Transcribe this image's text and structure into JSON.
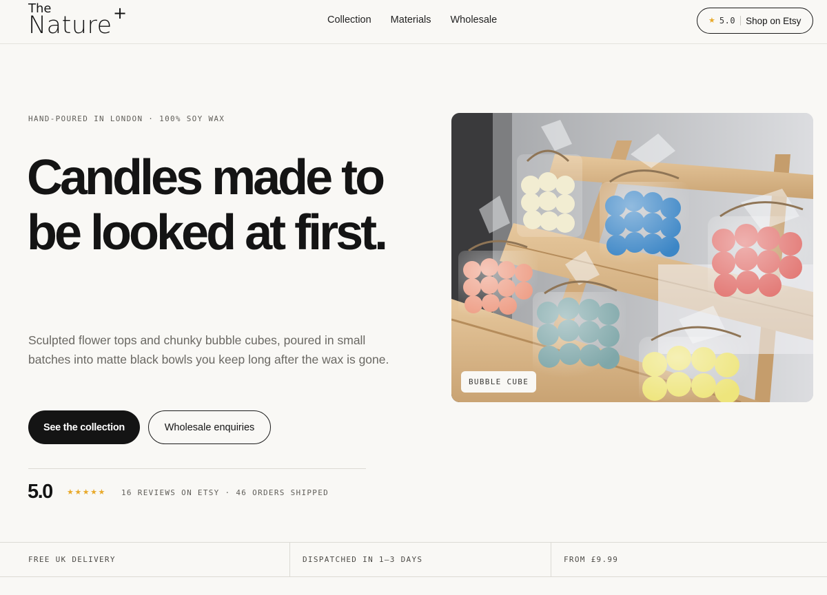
{
  "brand": {
    "the": "The",
    "nature": "Nature",
    "plus": "+"
  },
  "nav": {
    "links": [
      "Collection",
      "Materials",
      "Wholesale"
    ]
  },
  "etsy": {
    "rating": "5.0",
    "label": "Shop on Etsy",
    "icon": "star-icon"
  },
  "hero": {
    "eyebrow": "HAND-POURED IN LONDON · 100% SOY WAX",
    "headline": "Candles made to be looked at first.",
    "subtext": "Sculpted flower tops and chunky bubble cubes, poured in small batches into matte black bowls you keep long after the wax is gone.",
    "primary_cta": "See the collection",
    "secondary_cta": "Wholesale enquiries",
    "image_tag": "BUBBLE CUBE"
  },
  "rating": {
    "score": "5.0",
    "stars": "★★★★★",
    "meta": "16 REVIEWS ON ETSY · 46 ORDERS SHIPPED"
  },
  "features": [
    "FREE UK DELIVERY",
    "DISPATCHED IN 1–3 DAYS",
    "FROM £9.99"
  ],
  "colors": {
    "background": "#f9f8f5",
    "ink": "#141414",
    "star": "#e8a92a",
    "muted": "#6a6863"
  }
}
